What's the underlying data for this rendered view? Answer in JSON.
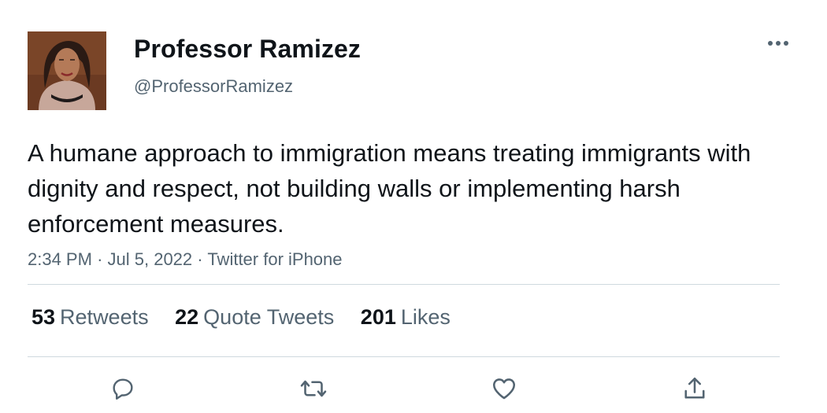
{
  "author": {
    "display_name": "Professor Ramizez",
    "handle": "@ProfessorRamizez"
  },
  "tweet": {
    "text": "A humane approach to immigration means treating immigrants with dignity and respect, not building walls or implementing harsh enforcement measures.",
    "time": "2:34 PM",
    "date": "Jul 5, 2022",
    "source": "Twitter for iPhone"
  },
  "stats": {
    "retweets": {
      "count": "53",
      "label": "Retweets"
    },
    "quote_tweets": {
      "count": "22",
      "label": "Quote Tweets"
    },
    "likes": {
      "count": "201",
      "label": "Likes"
    }
  },
  "icons": {
    "more": "more-horizontal-icon",
    "reply": "reply-icon",
    "retweet": "retweet-icon",
    "like": "heart-icon",
    "share": "share-icon"
  },
  "colors": {
    "text_primary": "#0f1419",
    "text_secondary": "#536471",
    "divider": "#cfd9de"
  }
}
